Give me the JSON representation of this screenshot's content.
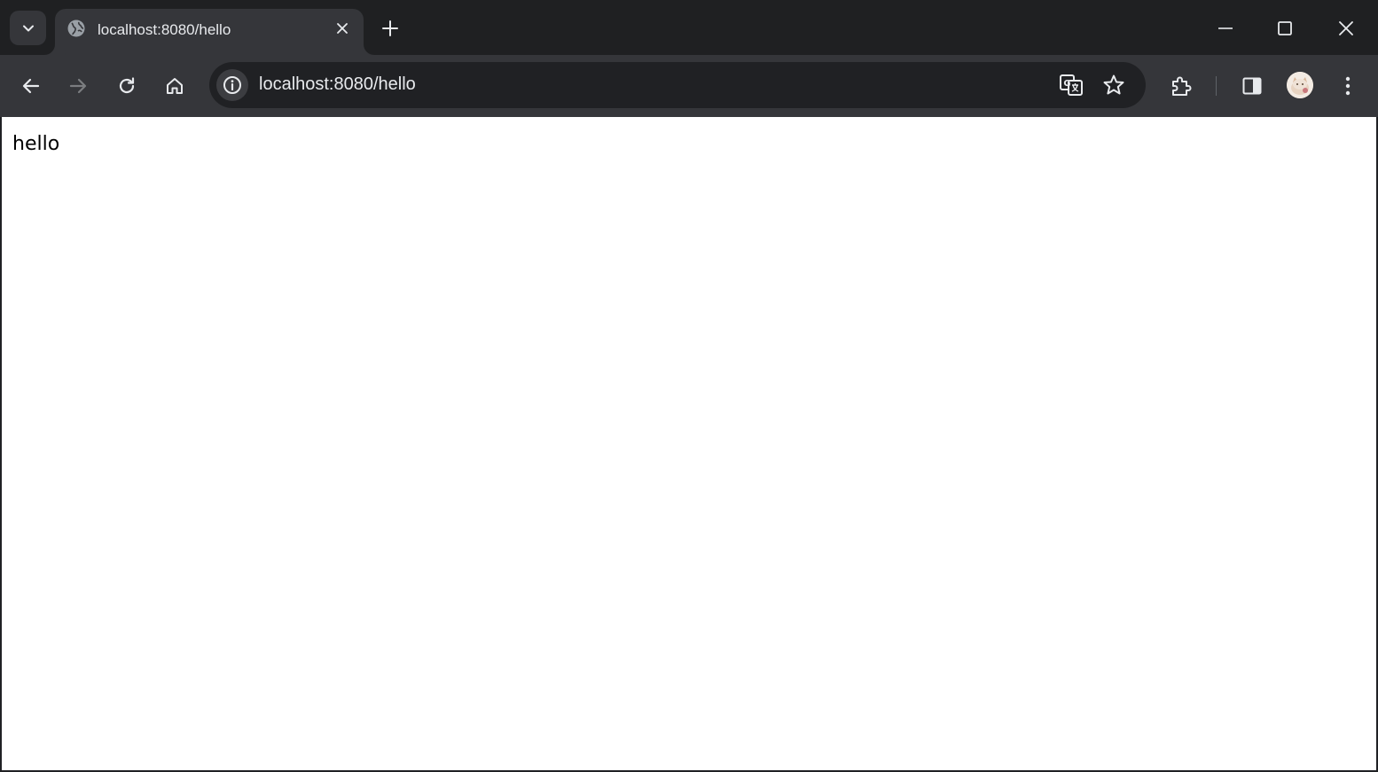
{
  "tab": {
    "title": "localhost:8080/hello"
  },
  "address_bar": {
    "url": "localhost:8080/hello"
  },
  "page": {
    "body_text": "hello"
  },
  "icons": {
    "tab_search": "chevron-down-icon",
    "favicon": "globe-icon",
    "tab_close": "close-icon",
    "new_tab": "plus-icon",
    "minimize": "minimize-icon",
    "maximize": "maximize-icon",
    "close_window": "close-icon",
    "back": "arrow-left-icon",
    "forward": "arrow-right-icon",
    "reload": "reload-icon",
    "home": "home-icon",
    "site_info": "info-icon",
    "translate": "translate-icon",
    "bookmark": "star-icon",
    "extensions": "puzzle-icon",
    "side_panel": "side-panel-icon",
    "profile": "avatar",
    "menu": "kebab-menu-icon"
  },
  "colors": {
    "frame": "#202124",
    "toolbar": "#35363a",
    "text": "#e8eaed",
    "page_background": "#ffffff"
  }
}
